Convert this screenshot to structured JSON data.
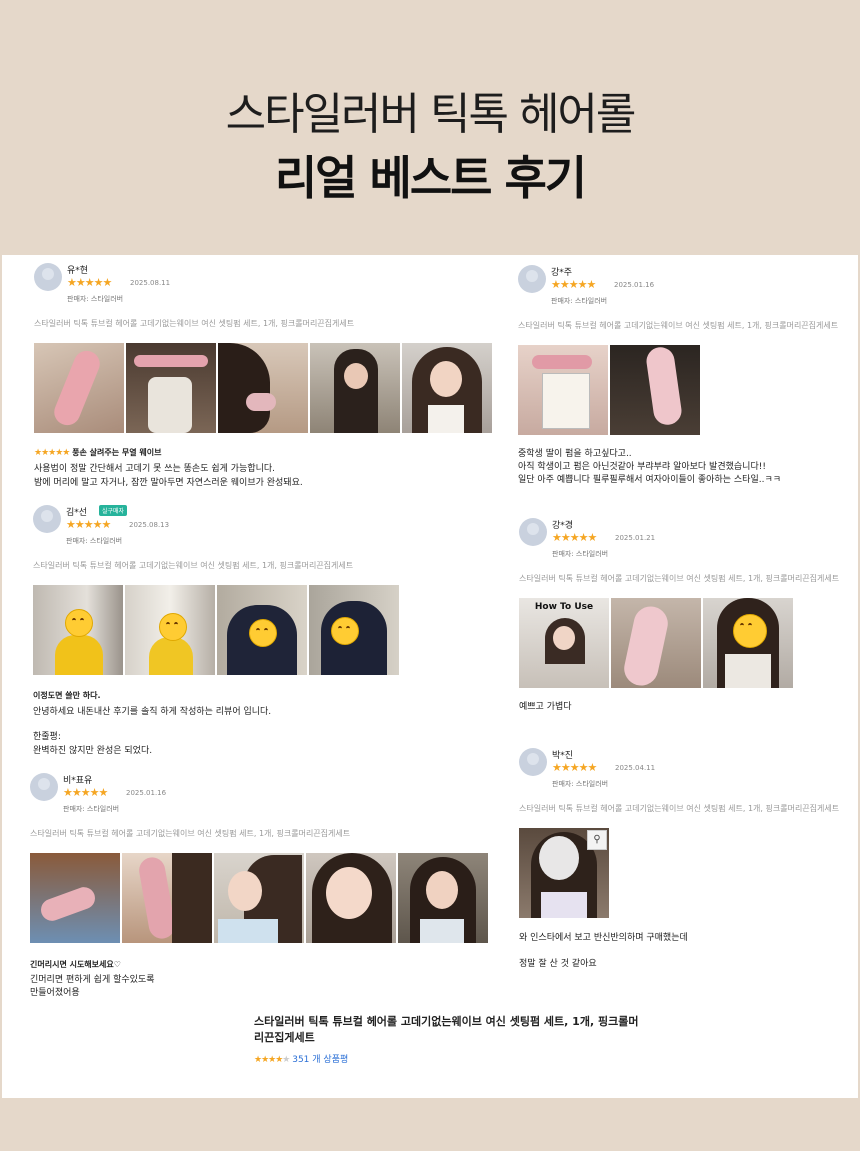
{
  "hero": {
    "line1": "스타일러버 틱톡 헤어롤",
    "line2": "리얼 베스트 후기"
  },
  "reviews": [
    {
      "user": "유*현",
      "stars": "★★★★★",
      "date": "2025.08.11",
      "seller": "판매자: 스타일러버",
      "product": "스타일러버 틱톡 튜브컬 헤어롤 고데기없는웨이브 여신 셋팅펌 세트, 1개, 핑크롤머리끈집게세트",
      "headline_stars": "★★★★★",
      "headline": "풍손 살려주는 무열 웨이브",
      "lines": [
        "사용법이 정말 간단해서 고데기 못 쓰는 똥손도 쉽게 가능합니다.",
        "밤에 머리에 말고 자거나, 잠깐 말아두면 자연스러운 웨이브가 완성돼요."
      ]
    },
    {
      "user": "김*선",
      "badge": "실구매자",
      "stars": "★★★★★",
      "date": "2025.08.13",
      "seller": "판매자: 스타일러버",
      "product": "스타일러버 틱톡 튜브컬 헤어롤 고데기없는웨이브 여신 셋팅펌 세트, 1개, 핑크롤머리끈집게세트",
      "headline": "이정도면 쓸만 하다.",
      "lines": [
        "안녕하세요 내돈내산 후기를 솔직 하게 작성하는 리뷰어 입니다.",
        "",
        "한줄평:",
        "완벽하진 않지만 완성은 되었다."
      ]
    },
    {
      "user": "비*표유",
      "stars": "★★★★★",
      "date": "2025.01.16",
      "seller": "판매자: 스타일러버",
      "product": "스타일러버 틱톡 튜브컬 헤어롤 고데기없는웨이브 여신 셋팅펌 세트, 1개, 핑크롤머리끈집게세트",
      "headline": "긴머리시면 시도해보세요♡",
      "lines": [
        "긴머리면 편하게 쉽게 할수있도록",
        "만들어졌어용"
      ]
    },
    {
      "user": "강*주",
      "stars": "★★★★★",
      "date": "2025.01.16",
      "seller": "판매자: 스타일러버",
      "product": "스타일러버 틱톡 튜브컬 헤어롤 고데기없는웨이브 여신 셋팅펌 세트, 1개, 핑크롤머리끈집게세트",
      "lines": [
        "중학생 딸이 펌을 하고싶다고..",
        "아직 학생이고 펌은 아닌것같아 부랴부랴 알아보다 발견했습니다!!",
        "일단 아주 예쁩니다 필루필루해서 여자아이들이 좋아하는 스타일..ㅋㅋ"
      ]
    },
    {
      "user": "강*경",
      "stars": "★★★★★",
      "date": "2025.01.21",
      "seller": "판매자: 스타일러버",
      "product": "스타일러버 틱톡 튜브컬 헤어롤 고데기없는웨이브 여신 셋팅펌 세트, 1개, 핑크롤머리끈집게세트",
      "photo_caption": "How To Use",
      "lines": [
        "예쁘고 가볍다"
      ]
    },
    {
      "user": "박*진",
      "stars": "★★★★★",
      "date": "2025.04.11",
      "seller": "판매자: 스타일러버",
      "product": "스타일러버 틱톡 튜브컬 헤어롤 고데기없는웨이브 여신 셋팅펌 세트, 1개, 핑크롤머리끈집게세트",
      "lines": [
        "와 인스타에서 보고 반신반의하며 구매했는데",
        "정말 잘 산 것 같아요"
      ]
    }
  ],
  "footer": {
    "title": "스타일러버 틱톡 튜브컬 헤어롤 고데기없는웨이브 여신 셋팅펌 세트, 1개, 핑크롤머리끈집게세트",
    "stars_on": "★★★★",
    "stars_off": "★",
    "count": "351 개 상품평"
  },
  "colors": {
    "background": "#e5d8ca",
    "star": "#f5a623",
    "badge": "#26b39b",
    "link": "#2a6fd6"
  }
}
